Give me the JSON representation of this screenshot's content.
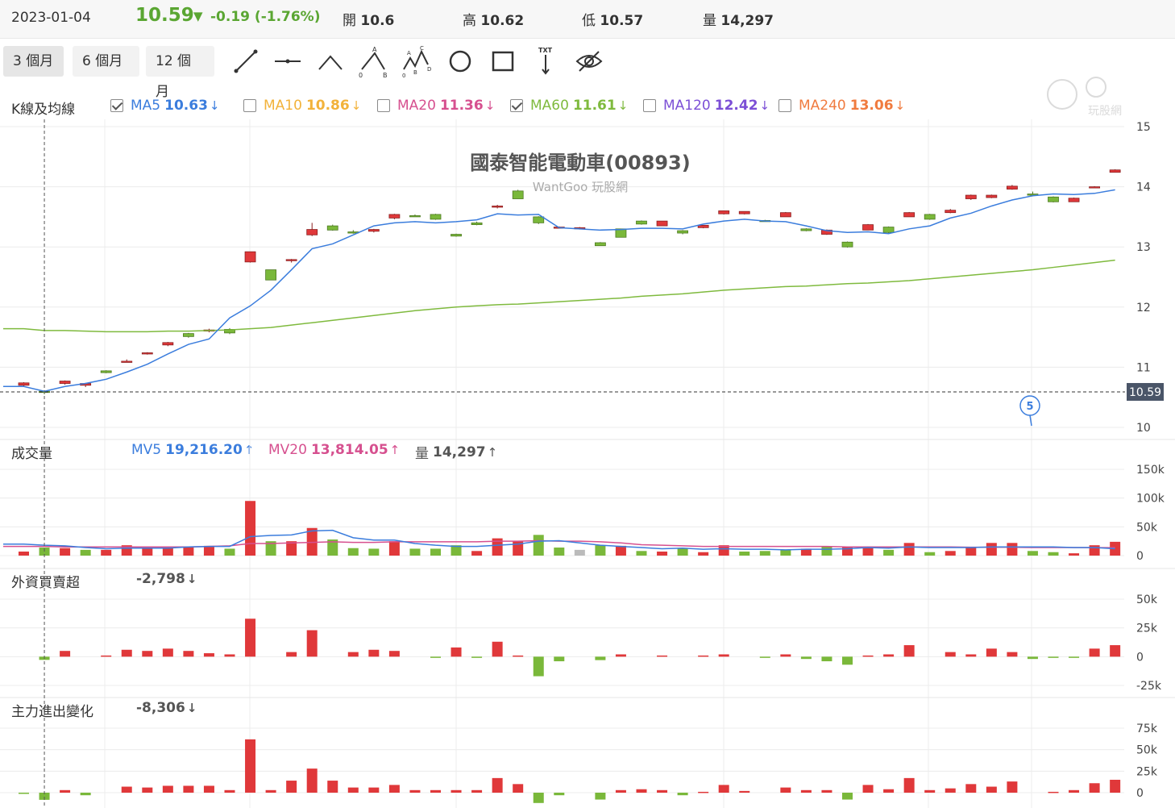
{
  "header": {
    "date": "2023-01-04",
    "price": "10.59",
    "change": "-0.19 (-1.76%)",
    "open_label": "開",
    "open": "10.6",
    "high_label": "高",
    "high": "10.62",
    "low_label": "低",
    "low": "10.57",
    "volume_label": "量",
    "volume": "14,297"
  },
  "toolbar": {
    "ranges": [
      "3 個月",
      "6 個月",
      "12 個月"
    ],
    "active_range": "3 個月",
    "tools": [
      "line-tool-icon",
      "horizontal-line-icon",
      "angle-line-icon",
      "abc-pattern-icon",
      "abcd-pattern-icon",
      "circle-tool-icon",
      "rectangle-tool-icon",
      "text-tool-icon",
      "hide-drawings-icon"
    ]
  },
  "kline_panel": {
    "title": "K線及均線",
    "chart_title": "國泰智能電動車(00893)",
    "watermark": "WantGoo 玩股網",
    "logo_text": "玩股網",
    "current_price_tag": "10.59",
    "event_marker": "5",
    "legend": [
      {
        "name": "MA5",
        "value": "10.63",
        "dir": "↓",
        "checked": true,
        "color": "#3b7ddd"
      },
      {
        "name": "MA10",
        "value": "10.86",
        "dir": "↓",
        "checked": false,
        "color": "#f2b23a"
      },
      {
        "name": "MA20",
        "value": "11.36",
        "dir": "↓",
        "checked": false,
        "color": "#d6508f"
      },
      {
        "name": "MA60",
        "value": "11.61",
        "dir": "↓",
        "checked": true,
        "color": "#7fba3e"
      },
      {
        "name": "MA120",
        "value": "12.42",
        "dir": "↓",
        "checked": false,
        "color": "#7c4fd6"
      },
      {
        "name": "MA240",
        "value": "13.06",
        "dir": "↓",
        "checked": false,
        "color": "#f07b3f"
      }
    ]
  },
  "volume_panel": {
    "title": "成交量",
    "legend": [
      {
        "name": "MV5",
        "value": "19,216.20",
        "dir": "↑",
        "color": "#3b7ddd"
      },
      {
        "name": "MV20",
        "value": "13,814.05",
        "dir": "↑",
        "color": "#d6508f"
      },
      {
        "name": "量",
        "value": "14,297",
        "dir": "↑",
        "color": "#555555"
      }
    ]
  },
  "foreign_panel": {
    "title": "外資買賣超",
    "value": "-2,798",
    "dir": "↓"
  },
  "main_panel": {
    "title": "主力進出變化",
    "value": "-8,306",
    "dir": "↓"
  },
  "colors": {
    "up": "#e0383a",
    "down": "#7ab83a",
    "neutral": "#bbbbbb",
    "ma5": "#3b7ddd",
    "ma60": "#7fba3e",
    "mv20": "#d6508f"
  },
  "chart_data": [
    {
      "type": "candlestick",
      "title": "國泰智能電動車(00893)",
      "ylim": [
        10,
        15
      ],
      "yticks": [
        "15",
        "14",
        "13",
        "12",
        "11",
        "10"
      ],
      "ohlc": [
        [
          10.7,
          10.75,
          10.68,
          10.74
        ],
        [
          10.6,
          10.61,
          10.55,
          10.58
        ],
        [
          10.73,
          10.78,
          10.71,
          10.77
        ],
        [
          10.7,
          10.74,
          10.67,
          10.73
        ],
        [
          10.94,
          10.95,
          10.9,
          10.91
        ],
        [
          11.1,
          11.13,
          11.08,
          11.1
        ],
        [
          11.22,
          11.25,
          11.21,
          11.24
        ],
        [
          11.37,
          11.42,
          11.35,
          11.41
        ],
        [
          11.56,
          11.57,
          11.49,
          11.51
        ],
        [
          11.6,
          11.64,
          11.58,
          11.62
        ],
        [
          11.63,
          11.65,
          11.55,
          11.57
        ],
        [
          12.75,
          12.92,
          12.74,
          12.92
        ],
        [
          12.62,
          12.62,
          12.45,
          12.45
        ],
        [
          12.78,
          12.8,
          12.74,
          12.79
        ],
        [
          13.2,
          13.4,
          13.18,
          13.29
        ],
        [
          13.35,
          13.37,
          13.27,
          13.28
        ],
        [
          13.25,
          13.28,
          13.22,
          13.24
        ],
        [
          13.26,
          13.3,
          13.24,
          13.29
        ],
        [
          13.48,
          13.55,
          13.46,
          13.54
        ],
        [
          13.52,
          13.54,
          13.5,
          13.51
        ],
        [
          13.54,
          13.55,
          13.45,
          13.46
        ],
        [
          13.21,
          13.22,
          13.17,
          13.18
        ],
        [
          13.4,
          13.42,
          13.36,
          13.37
        ],
        [
          13.66,
          13.7,
          13.64,
          13.68
        ],
        [
          13.93,
          13.95,
          13.8,
          13.8
        ],
        [
          13.5,
          13.51,
          13.38,
          13.4
        ],
        [
          13.33,
          13.34,
          13.32,
          13.33
        ],
        [
          13.3,
          13.33,
          13.29,
          13.32
        ],
        [
          13.07,
          13.08,
          13.02,
          13.02
        ],
        [
          13.3,
          13.3,
          13.16,
          13.16
        ],
        [
          13.43,
          13.44,
          13.37,
          13.38
        ],
        [
          13.35,
          13.43,
          13.35,
          13.43
        ],
        [
          13.27,
          13.28,
          13.21,
          13.23
        ],
        [
          13.32,
          13.36,
          13.31,
          13.36
        ],
        [
          13.55,
          13.6,
          13.54,
          13.6
        ],
        [
          13.55,
          13.59,
          13.54,
          13.59
        ],
        [
          13.44,
          13.45,
          13.42,
          13.43
        ],
        [
          13.5,
          13.58,
          13.5,
          13.57
        ],
        [
          13.3,
          13.31,
          13.26,
          13.27
        ],
        [
          13.21,
          13.29,
          13.2,
          13.28
        ],
        [
          13.08,
          13.09,
          12.99,
          13.0
        ],
        [
          13.28,
          13.38,
          13.28,
          13.37
        ],
        [
          13.33,
          13.34,
          13.23,
          13.24
        ],
        [
          13.5,
          13.58,
          13.5,
          13.57
        ],
        [
          13.54,
          13.55,
          13.45,
          13.46
        ],
        [
          13.57,
          13.63,
          13.56,
          13.61
        ],
        [
          13.8,
          13.87,
          13.78,
          13.86
        ],
        [
          13.82,
          13.87,
          13.81,
          13.86
        ],
        [
          13.96,
          14.03,
          13.95,
          14.01
        ],
        [
          13.88,
          13.92,
          13.84,
          13.86
        ],
        [
          13.83,
          13.84,
          13.74,
          13.75
        ],
        [
          13.75,
          13.82,
          13.75,
          13.81
        ],
        [
          14.0,
          14.01,
          13.99,
          14.0
        ],
        [
          14.24,
          14.29,
          14.24,
          14.28
        ]
      ],
      "ma5": [
        10.68,
        10.6,
        10.68,
        10.73,
        10.8,
        10.92,
        11.05,
        11.22,
        11.38,
        11.47,
        11.82,
        12.02,
        12.28,
        12.62,
        12.97,
        13.05,
        13.2,
        13.35,
        13.4,
        13.42,
        13.4,
        13.42,
        13.45,
        13.55,
        13.53,
        13.54,
        13.32,
        13.3,
        13.28,
        13.29,
        13.31,
        13.31,
        13.3,
        13.38,
        13.43,
        13.46,
        13.43,
        13.42,
        13.35,
        13.27,
        13.24,
        13.25,
        13.22,
        13.3,
        13.35,
        13.48,
        13.56,
        13.68,
        13.78,
        13.85,
        13.88,
        13.87,
        13.89,
        13.95
      ],
      "ma60": [
        11.64,
        11.61,
        11.61,
        11.6,
        11.59,
        11.59,
        11.59,
        11.6,
        11.6,
        11.61,
        11.62,
        11.64,
        11.66,
        11.7,
        11.74,
        11.78,
        11.82,
        11.86,
        11.9,
        11.94,
        11.97,
        12.0,
        12.02,
        12.04,
        12.05,
        12.07,
        12.09,
        12.11,
        12.13,
        12.15,
        12.18,
        12.2,
        12.22,
        12.25,
        12.28,
        12.3,
        12.32,
        12.34,
        12.35,
        12.37,
        12.39,
        12.4,
        12.42,
        12.44,
        12.47,
        12.5,
        12.53,
        12.56,
        12.59,
        12.62,
        12.66,
        12.7,
        12.74,
        12.78
      ]
    },
    {
      "type": "bar",
      "title": "成交量",
      "ylim": [
        0,
        150000
      ],
      "yticks": [
        "150k",
        "100k",
        "50k",
        "0"
      ],
      "values": [
        7000,
        14000,
        13000,
        10000,
        10000,
        18000,
        13000,
        15000,
        16000,
        17000,
        12000,
        95000,
        25000,
        25000,
        48000,
        28000,
        13000,
        12000,
        25000,
        12000,
        12000,
        18000,
        8000,
        30000,
        25000,
        36000,
        14000,
        10000,
        18000,
        17000,
        8000,
        7000,
        12000,
        6000,
        18000,
        7000,
        8000,
        10000,
        12000,
        16000,
        15000,
        16000,
        10000,
        22000,
        6000,
        8000,
        15000,
        22000,
        22000,
        8000,
        6000,
        4000,
        18000,
        24000
      ],
      "colors": [
        "up",
        "down",
        "up",
        "down",
        "up",
        "up",
        "up",
        "up",
        "up",
        "up",
        "down",
        "up",
        "down",
        "up",
        "up",
        "down",
        "down",
        "down",
        "up",
        "down",
        "down",
        "down",
        "up",
        "up",
        "up",
        "down",
        "down",
        "neutral",
        "down",
        "up",
        "down",
        "up",
        "down",
        "up",
        "up",
        "down",
        "down",
        "down",
        "up",
        "down",
        "up",
        "up",
        "down",
        "up",
        "down",
        "up",
        "up",
        "up",
        "up",
        "down",
        "down",
        "up",
        "up",
        "up"
      ],
      "mv5": [
        20000,
        18000,
        17000,
        14000,
        12000,
        13000,
        13000,
        13000,
        15000,
        16000,
        16000,
        33000,
        35000,
        36000,
        43000,
        44000,
        31000,
        27000,
        27000,
        21000,
        18000,
        16000,
        16000,
        18000,
        20000,
        25000,
        26000,
        22000,
        18000,
        16000,
        14000,
        12000,
        13000,
        11000,
        12000,
        11000,
        11000,
        10000,
        11000,
        11000,
        12000,
        14000,
        13000,
        15000,
        14000,
        14000,
        14000,
        15000,
        15000,
        15000,
        15000,
        14000,
        14000,
        12000
      ],
      "mv20": [
        16000,
        16000,
        15000,
        15000,
        15000,
        15000,
        15000,
        15000,
        15000,
        16000,
        17000,
        21000,
        21000,
        22000,
        23000,
        24000,
        23000,
        23000,
        24000,
        24000,
        24000,
        24000,
        24000,
        25000,
        25000,
        26000,
        25000,
        25000,
        24000,
        22000,
        19000,
        18000,
        17000,
        16000,
        16000,
        16000,
        16000,
        16000,
        16000,
        16000,
        15000,
        15000,
        15000,
        15000,
        15000,
        15000,
        14500,
        14500,
        14500,
        14000,
        14000,
        14000,
        13900,
        13814
      ]
    },
    {
      "type": "bar",
      "title": "外資買賣超",
      "ylim": [
        -25000,
        50000
      ],
      "yticks": [
        "50k",
        "25k",
        "0",
        "-25k"
      ],
      "values": [
        0,
        -2798,
        5000,
        0,
        1000,
        6000,
        5000,
        7000,
        5000,
        3000,
        2000,
        33000,
        0,
        4000,
        23000,
        0,
        4000,
        6000,
        5000,
        0,
        -1000,
        8000,
        -1000,
        13000,
        1000,
        -17000,
        -4000,
        0,
        -3000,
        2000,
        0,
        1000,
        0,
        1000,
        2000,
        0,
        -1000,
        2000,
        -2000,
        -4000,
        -7000,
        1000,
        2000,
        10000,
        0,
        4000,
        2000,
        7000,
        4000,
        -2000,
        -1000,
        -1000,
        7000,
        10000
      ]
    },
    {
      "type": "bar",
      "title": "主力進出變化",
      "ylim": [
        0,
        75000
      ],
      "yticks": [
        "75k",
        "50k",
        "25k",
        "0"
      ],
      "values": [
        -1000,
        -8306,
        3000,
        -3000,
        0,
        7000,
        6000,
        8000,
        8000,
        8000,
        3000,
        62000,
        3000,
        14000,
        28000,
        14000,
        6000,
        6000,
        9000,
        3000,
        3000,
        3000,
        3000,
        17000,
        10000,
        -12000,
        -3000,
        0,
        -8000,
        3000,
        4000,
        3000,
        -3000,
        1000,
        9000,
        2000,
        0,
        6000,
        3000,
        3000,
        -8000,
        9000,
        4000,
        17000,
        3000,
        5000,
        10000,
        7000,
        13000,
        0,
        1000,
        3000,
        11000,
        15000
      ]
    }
  ]
}
